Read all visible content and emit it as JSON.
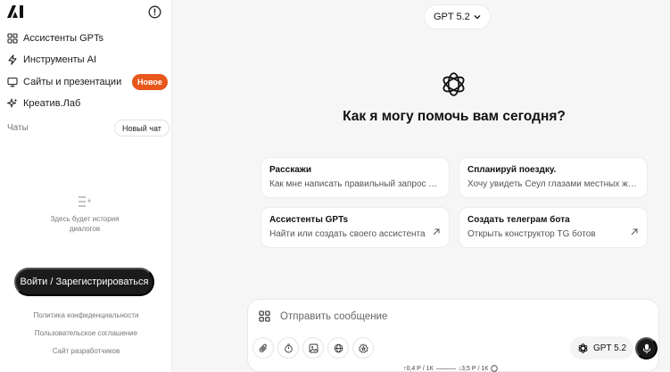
{
  "sidebar": {
    "items": [
      {
        "label": "Ассистенты GPTs"
      },
      {
        "label": "Инструменты AI"
      },
      {
        "label": "Сайты и презентации",
        "badge": "Новое"
      },
      {
        "label": "Креатив.Лаб"
      }
    ],
    "chats_label": "Чаты",
    "new_chat_label": "Новый чат",
    "empty_history": "Здесь будет история диалогов",
    "login_label": "Войти / Зарегистрироваться",
    "footer_links": [
      "Политика конфиденциальности",
      "Пользовательское соглашение",
      "Сайт разработчиков"
    ]
  },
  "header": {
    "model_selector": "GPT 5.2"
  },
  "main": {
    "headline": "Как я могу помочь вам сегодня?",
    "cards": [
      {
        "title": "Расскажи",
        "subtitle": "Как мне написать правильный запрос в ч..."
      },
      {
        "title": "Спланируй поездку.",
        "subtitle": "Хочу увидеть Сеул глазами местных жит..."
      },
      {
        "title": "Ассистенты GPTs",
        "subtitle": "Найти или создать своего ассистента"
      },
      {
        "title": "Создать телеграм бота",
        "subtitle": "Открыть конструктор TG ботов"
      }
    ]
  },
  "composer": {
    "placeholder": "Отправить сообщение",
    "model_label": "GPT 5.2",
    "price_in": "↑0,4 Р / 1К",
    "price_out": "↓3,5 Р / 1К"
  },
  "colors": {
    "accent": "#e8571c",
    "dark": "#1b1b1b"
  }
}
